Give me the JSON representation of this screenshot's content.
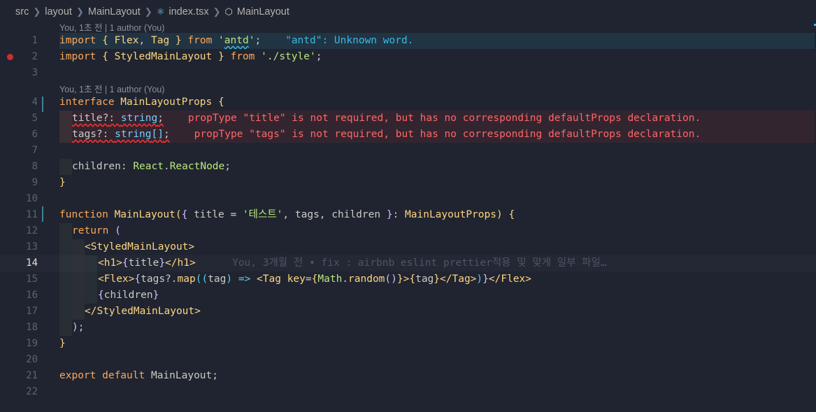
{
  "breadcrumb": {
    "parts": [
      "src",
      "layout",
      "MainLayout",
      "index.tsx",
      "MainLayout"
    ],
    "file_icon": "react-icon",
    "symbol_icon": "cube-icon"
  },
  "codelens": {
    "top": "You, 1초 전 | 1 author (You)",
    "interface": "You, 1초 전 | 1 author (You)"
  },
  "lines": {
    "n1": "1",
    "n2": "2",
    "n3": "3",
    "n4": "4",
    "n5": "5",
    "n6": "6",
    "n7": "7",
    "n8": "8",
    "n9": "9",
    "n10": "10",
    "n11": "11",
    "n12": "12",
    "n13": "13",
    "n14": "14",
    "n15": "15",
    "n16": "16",
    "n17": "17",
    "n18": "18",
    "n19": "19",
    "n20": "20",
    "n21": "21",
    "n22": "22"
  },
  "code": {
    "l1": {
      "import": "import",
      "ob": "{ ",
      "flex": "Flex",
      "comma": ", ",
      "tag": "Tag",
      "cb": " }",
      "from": " from ",
      "q1": "'",
      "mod": "antd",
      "q2": "'",
      "semi": ";"
    },
    "l2": {
      "import": "import",
      "ob": "{ ",
      "name": "StyledMainLayout",
      "cb": " }",
      "from": " from ",
      "mod": "'./style'",
      "semi": ";"
    },
    "l4": {
      "kw": "interface",
      "name": " MainLayoutProps",
      "ob": " {"
    },
    "l5": {
      "prop": "title?",
      "colon": ": ",
      "type": "string",
      "semi": ";"
    },
    "l6": {
      "prop": "tags?",
      "colon": ": ",
      "type": "string",
      "arr": "[]",
      "semi": ";"
    },
    "l8": {
      "prop": "children",
      "colon": ": ",
      "ns": "React",
      "dot": ".",
      "type": "ReactNode",
      "semi": ";"
    },
    "l9": {
      "cb": "}"
    },
    "l11": {
      "kw": "function",
      "name": " MainLayout",
      "op": "(",
      "ob": "{ ",
      "p1": "title",
      "eq": " = ",
      "str": "'테스트'",
      "rest": ", tags, children ",
      "cb": "}",
      "colon": ": ",
      "type": "MainLayoutProps",
      "cp": ")",
      "ob2": " {"
    },
    "l12": {
      "kw": "return",
      "op": " ("
    },
    "l13": {
      "tag": "<StyledMainLayout>"
    },
    "l14": {
      "t1": "<h1>",
      "o": "{",
      "v": "title",
      "c": "}",
      "t2": "</h1>"
    },
    "l15": {
      "t1": "<Flex>",
      "o": "{",
      "a": "tags?.",
      "fn": "map",
      "p": "((",
      "arg": "tag",
      "p2": ") => ",
      "t2": "<Tag ",
      "attr": "key",
      "eq": "=",
      "o2": "{",
      "obj": "Math",
      "dot": ".",
      "fn2": "random",
      "call": "()",
      "c2": "}",
      "gt": ">",
      "o3": "{",
      "v": "tag",
      "c3": "}",
      "t3": "</Tag>",
      "p3": ")",
      "c": "}",
      "t4": "</Flex>"
    },
    "l16": {
      "o": "{",
      "v": "children",
      "c": "}"
    },
    "l17": {
      "tag": "</StyledMainLayout>"
    },
    "l18": {
      "cp": ")",
      "semi": ";"
    },
    "l19": {
      "cb": "}"
    },
    "l21": {
      "kw1": "export",
      "kw2": " default",
      "name": " MainLayout",
      "semi": ";"
    }
  },
  "diagnostics": {
    "l1": "\"antd\": Unknown word.",
    "l5": "propType \"title\" is not required, but has no corresponding defaultProps declaration.",
    "l6": "propType \"tags\" is not required, but has no corresponding defaultProps declaration."
  },
  "blame": {
    "l14": "You, 3개월 전 • fix : airbnb eslint prettier적용 및 맞게 일부 파일…"
  },
  "colors": {
    "background": "#1f2430",
    "keyword": "#ffa759",
    "type": "#73d0ff",
    "string": "#bae67e",
    "function": "#ffd580",
    "tag": "#5ccfe6",
    "error": "#ff6666",
    "info": "#39bae6"
  }
}
